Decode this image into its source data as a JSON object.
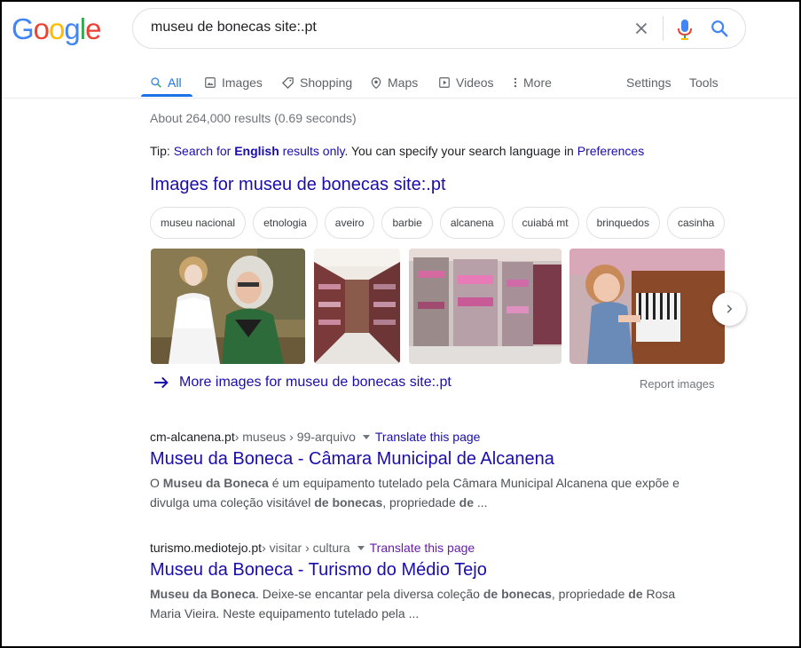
{
  "logo": {
    "letters": [
      "G",
      "o",
      "o",
      "g",
      "l",
      "e"
    ],
    "colors": [
      "#4285f4",
      "#ea4335",
      "#fbbc05",
      "#4285f4",
      "#34a853",
      "#ea4335"
    ]
  },
  "search": {
    "query": "museu de bonecas site:.pt"
  },
  "tabs": [
    {
      "label": "All",
      "icon": "search-icon"
    },
    {
      "label": "Images",
      "icon": "image-icon"
    },
    {
      "label": "Shopping",
      "icon": "tag-icon"
    },
    {
      "label": "Maps",
      "icon": "map-pin-icon"
    },
    {
      "label": "Videos",
      "icon": "play-icon"
    },
    {
      "label": "More",
      "icon": "more-vert-icon"
    }
  ],
  "tools": {
    "settings": "Settings",
    "tools": "Tools"
  },
  "stats": "About 264,000 results (0.69 seconds)",
  "tip": {
    "prefix": "Tip: ",
    "link_1": "Search for",
    "link_bold": "English",
    "link_2": "results only",
    "middle": ". You can specify your search language in ",
    "pref_link": "Preferences"
  },
  "images": {
    "heading": "Images for museu de bonecas site:.pt",
    "chips": [
      "museu nacional",
      "etnologia",
      "aveiro",
      "barbie",
      "alcanena",
      "cuiabá mt",
      "brinquedos",
      "casinha"
    ],
    "more_link": "More images for museu de bonecas site:.pt",
    "report": "Report images"
  },
  "results": [
    {
      "domain": "cm-alcanena.pt",
      "path": " › museus › 99-arquivo",
      "translate": "Translate this page",
      "title": "Museu da Boneca - Câmara Municipal de Alcanena",
      "snippet": [
        {
          "t": "O ",
          "b": false
        },
        {
          "t": "Museu da Boneca",
          "b": true
        },
        {
          "t": " é um equipamento tutelado pela Câmara Municipal Alcanena que expõe e divulga uma coleção visitável ",
          "b": false
        },
        {
          "t": "de bonecas",
          "b": true
        },
        {
          "t": ", propriedade ",
          "b": false
        },
        {
          "t": "de",
          "b": true
        },
        {
          "t": " ...",
          "b": false
        }
      ]
    },
    {
      "domain": "turismo.mediotejo.pt",
      "path": " › visitar › cultura",
      "translate": "Translate this page",
      "title": "Museu da Boneca - Turismo do Médio Tejo",
      "snippet": [
        {
          "t": "Museu da Boneca",
          "b": true
        },
        {
          "t": ". Deixe-se encantar pela diversa coleção ",
          "b": false
        },
        {
          "t": "de bonecas",
          "b": true
        },
        {
          "t": ", propriedade ",
          "b": false
        },
        {
          "t": "de",
          "b": true
        },
        {
          "t": " Rosa Maria Vieira. Neste equipamento tutelado pela ...",
          "b": false
        }
      ]
    }
  ]
}
